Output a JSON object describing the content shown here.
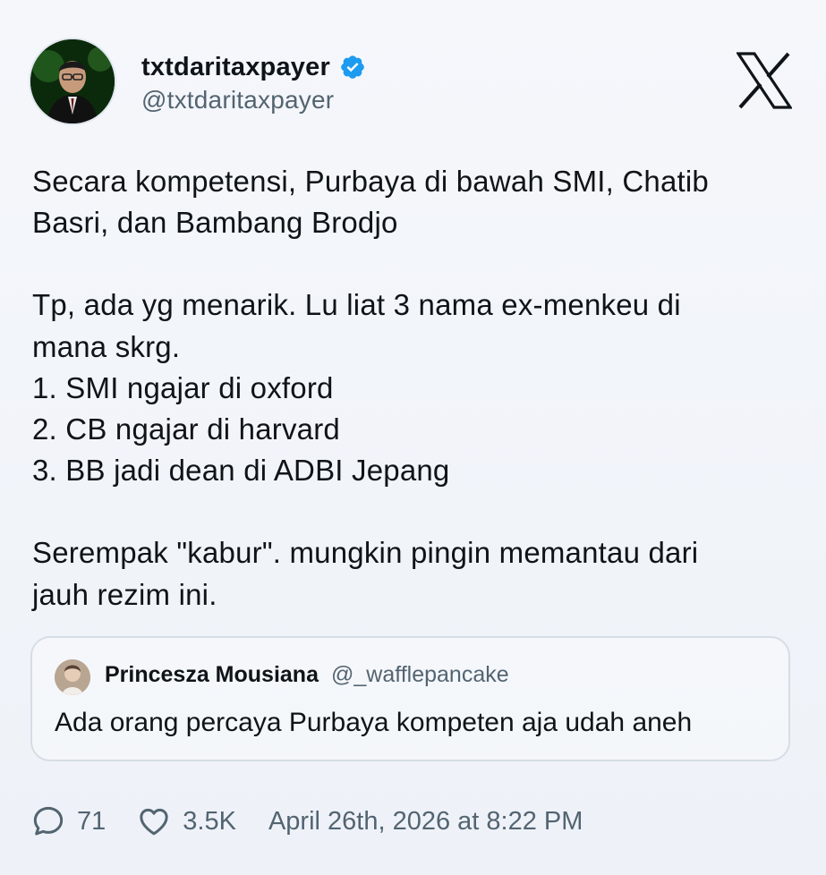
{
  "author": {
    "display_name": "txtdaritaxpayer",
    "handle": "@txtdaritaxpayer",
    "verified": true,
    "verified_color": "#1d9bf0"
  },
  "platform_logo": "x-logo-icon",
  "tweet": {
    "paragraphs": [
      "Secara kompetensi, Purbaya di bawah SMI, Chatib\nBasri, dan Bambang Brodjo",
      "Tp, ada yg menarik. Lu liat 3 nama ex-menkeu di\nmana skrg.\n1. SMI ngajar di oxford\n2. CB ngajar di harvard\n3. BB jadi dean di ADBI Jepang",
      "Serempak \"kabur\". mungkin pingin memantau dari\njauh rezim ini."
    ]
  },
  "quoted_tweet": {
    "display_name": "Princesza Mousiana",
    "handle": "@_wafflepancake",
    "text": "Ada orang percaya Purbaya kompeten aja udah aneh"
  },
  "footer": {
    "reply_icon": "comment-icon",
    "reply_count": "71",
    "like_icon": "heart-icon",
    "like_count": "3.5K",
    "timestamp": "April 26th, 2026 at 8:22 PM"
  },
  "colors": {
    "text_primary": "#0f1419",
    "text_secondary": "#536471",
    "border": "#d6dde5"
  }
}
